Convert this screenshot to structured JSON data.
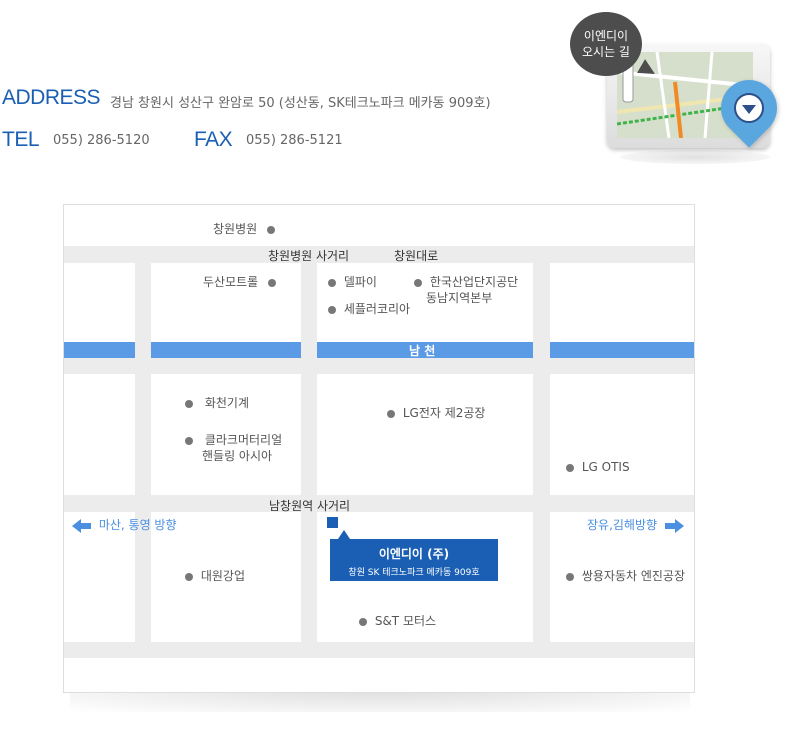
{
  "contact": {
    "address_label": "ADDRESS",
    "address_value": "경남 창원시 성산구 완암로 50 (성산동, SK테크노파크 메카동 909호)",
    "tel_label": "TEL",
    "tel_value": "055) 286-5120",
    "fax_label": "FAX",
    "fax_value": "055) 286-5121"
  },
  "directions_badge": {
    "line1": "이엔디이",
    "line2": "오시는 길"
  },
  "map": {
    "roads": {
      "top_intersection": "창원병원 사거리",
      "top_road": "창원대로",
      "bottom_intersection": "남창원역 사거리",
      "river": "남 천"
    },
    "places": {
      "changwon_hospital": "창원병원",
      "doosan_motrol": "두산모트롤",
      "delphi": "델파이",
      "kicox_line1": "한국산업단지공단",
      "kicox_line2": "동남지역본부",
      "sefuler": "세플러코리아",
      "hwacheon": "화천기계",
      "clark_line1": "클라크머터리얼",
      "clark_line2": "핸들링 아시아",
      "lg_plant2": "LG전자 제2공장",
      "lg_otis": "LG OTIS",
      "daewon": "대원강업",
      "snt": "S&T 모터스",
      "ssangyong": "쌍용자동차 엔진공장"
    },
    "directions": {
      "west": "마산, 통영 방향",
      "east": "장유,김해방향"
    },
    "company": {
      "name": "이엔디이 (주)",
      "address": "창원 SK 테크노파크 메카동 909호"
    }
  },
  "colors": {
    "accent": "#1a5fb4",
    "river": "#5b9be6",
    "road": "#ececec"
  }
}
